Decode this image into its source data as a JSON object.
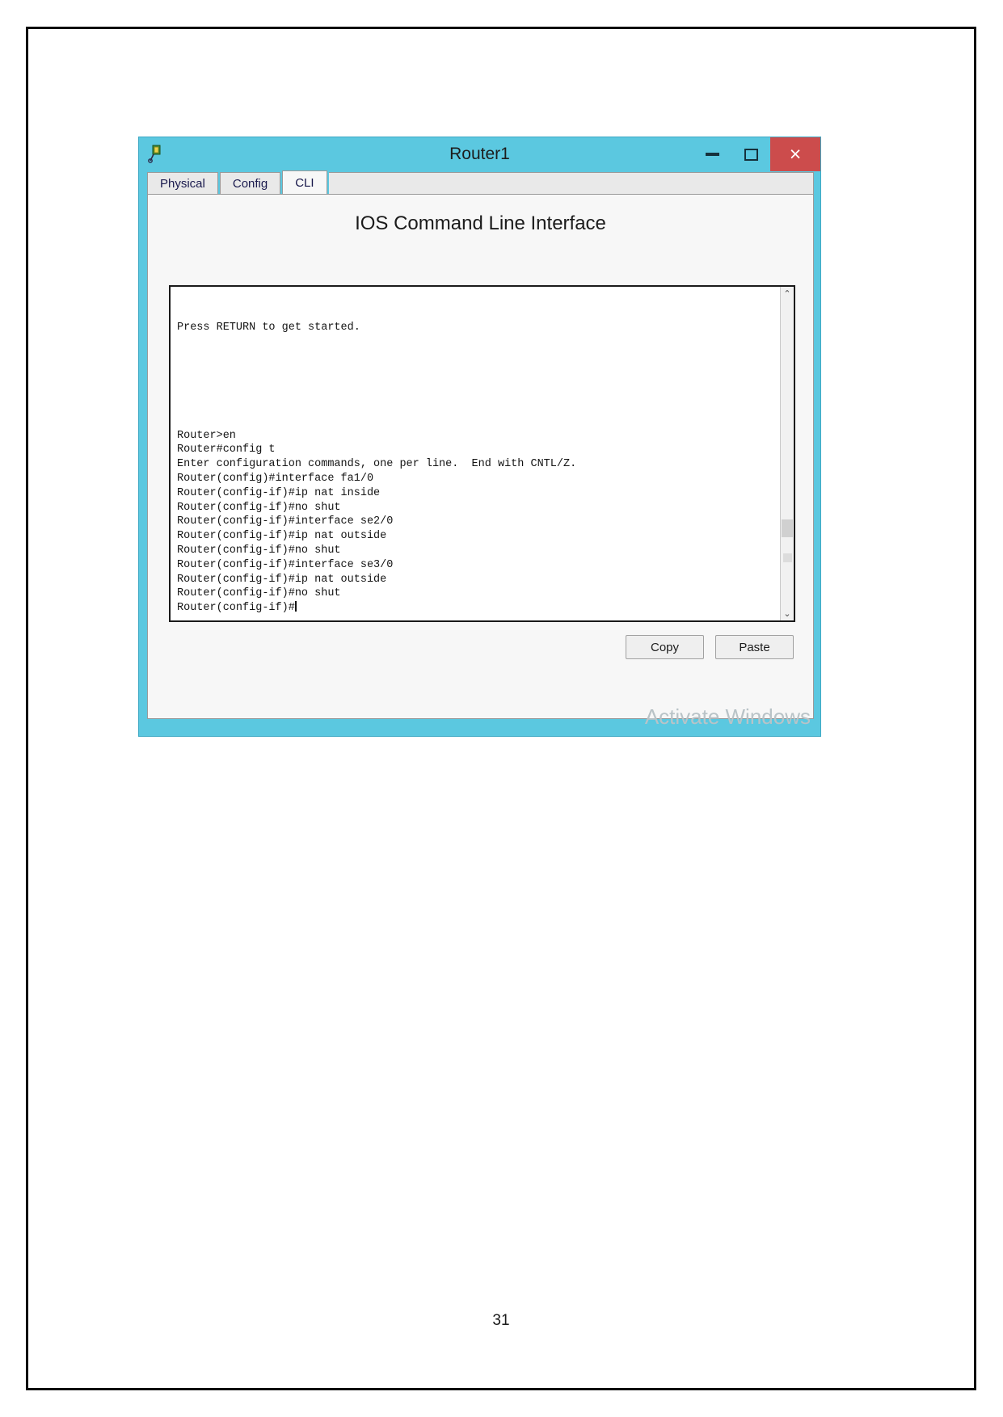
{
  "document": {
    "page_number": "31"
  },
  "window": {
    "title": "Router1",
    "icon": "router-device-icon",
    "controls": {
      "minimize_label": "−",
      "maximize_label": "□",
      "close_label": "×",
      "close_color": "#cc4c4c"
    },
    "titlebar_color": "#5bc8e0"
  },
  "tabs": [
    {
      "label": "Physical",
      "active": false
    },
    {
      "label": "Config",
      "active": false
    },
    {
      "label": "CLI",
      "active": true
    }
  ],
  "panel": {
    "heading": "IOS Command Line Interface"
  },
  "console": {
    "top_lines": [
      "Press RETURN to get started."
    ],
    "bottom_lines": [
      "Router>en",
      "Router#config t",
      "Enter configuration commands, one per line.  End with CNTL/Z.",
      "Router(config)#interface fa1/0",
      "Router(config-if)#ip nat inside",
      "Router(config-if)#no shut",
      "Router(config-if)#interface se2/0",
      "Router(config-if)#ip nat outside",
      "Router(config-if)#no shut",
      "Router(config-if)#interface se3/0",
      "Router(config-if)#ip nat outside",
      "Router(config-if)#no shut"
    ],
    "prompt_line": "Router(config-if)#",
    "scroll_up_glyph": "⌃",
    "scroll_down_glyph": "⌄"
  },
  "buttons": {
    "copy_label": "Copy",
    "paste_label": "Paste"
  },
  "watermark": {
    "text": "Activate Windows"
  }
}
